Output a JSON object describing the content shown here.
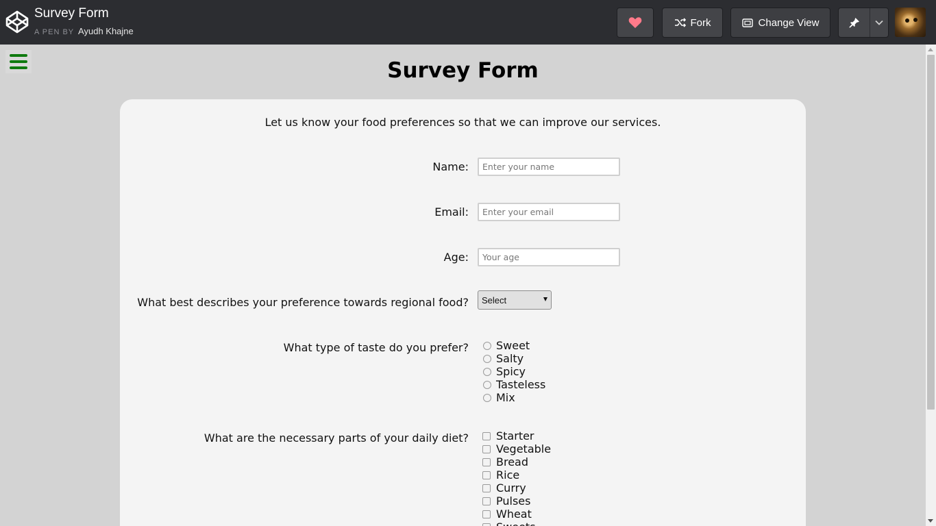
{
  "header": {
    "pen_title": "Survey Form",
    "pen_by_prefix": "A PEN BY",
    "author": "Ayudh Khajne",
    "fork_label": "Fork",
    "change_view_label": "Change View",
    "icons": {
      "logo": "codepen-logo-icon",
      "heart": "heart-icon",
      "fork": "fork-icon",
      "view": "change-view-icon",
      "pin": "pin-icon",
      "chevron": "chevron-down-icon"
    },
    "colors": {
      "heart": "#ff7a8a",
      "topbar": "#2c2d31"
    }
  },
  "page": {
    "title": "Survey Form",
    "description": "Let us know your food preferences so that we can improve our services.",
    "menu_icon": "hamburger-menu-icon",
    "menu_color": "#0f7a0f"
  },
  "form": {
    "name": {
      "label": "Name:",
      "placeholder": "Enter your name"
    },
    "email": {
      "label": "Email:",
      "placeholder": "Enter your email"
    },
    "age": {
      "label": "Age:",
      "placeholder": "Your age"
    },
    "regional": {
      "label": "What best describes your preference towards regional food?",
      "selected": "Select"
    },
    "taste": {
      "label": "What type of taste do you prefer?",
      "options": [
        "Sweet",
        "Salty",
        "Spicy",
        "Tasteless",
        "Mix"
      ]
    },
    "diet": {
      "label": "What are the necessary parts of your daily diet?",
      "options": [
        "Starter",
        "Vegetable",
        "Bread",
        "Rice",
        "Curry",
        "Pulses",
        "Wheat",
        "Sweets"
      ]
    }
  }
}
